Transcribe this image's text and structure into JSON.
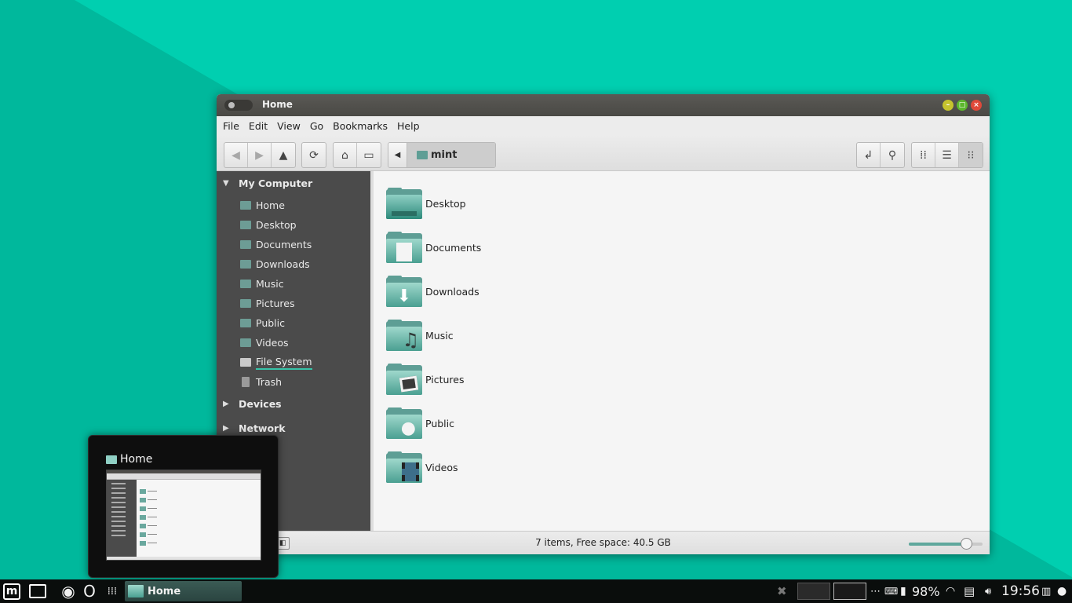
{
  "window": {
    "title": "Home",
    "menu": [
      "File",
      "Edit",
      "View",
      "Go",
      "Bookmarks",
      "Help"
    ],
    "pathbar": {
      "crumb": "mint"
    }
  },
  "sidebar": {
    "my_computer": "My Computer",
    "items": [
      {
        "label": "Home",
        "icon": "home-folder-icon"
      },
      {
        "label": "Desktop",
        "icon": "desktop-folder-icon"
      },
      {
        "label": "Documents",
        "icon": "documents-folder-icon"
      },
      {
        "label": "Downloads",
        "icon": "downloads-folder-icon"
      },
      {
        "label": "Music",
        "icon": "music-folder-icon"
      },
      {
        "label": "Pictures",
        "icon": "pictures-folder-icon"
      },
      {
        "label": "Public",
        "icon": "public-folder-icon"
      },
      {
        "label": "Videos",
        "icon": "videos-folder-icon"
      },
      {
        "label": "File System",
        "icon": "drive-icon"
      },
      {
        "label": "Trash",
        "icon": "trash-icon"
      }
    ],
    "devices": "Devices",
    "network": "Network"
  },
  "content": {
    "items": [
      {
        "name": "Desktop",
        "icon": "desktop-folder-icon"
      },
      {
        "name": "Documents",
        "icon": "documents-folder-icon"
      },
      {
        "name": "Downloads",
        "icon": "downloads-folder-icon"
      },
      {
        "name": "Music",
        "icon": "music-folder-icon"
      },
      {
        "name": "Pictures",
        "icon": "pictures-folder-icon"
      },
      {
        "name": "Public",
        "icon": "public-folder-icon"
      },
      {
        "name": "Videos",
        "icon": "videos-folder-icon"
      }
    ]
  },
  "statusbar": {
    "status": "7 items, Free space: 40.5 GB",
    "zoom_fraction": 0.78
  },
  "preview": {
    "title": "Home"
  },
  "taskbar": {
    "task_label": "Home",
    "battery": "98%",
    "clock": "19:56"
  },
  "colors": {
    "desktop": "#00cfb0",
    "accent": "#5e9e95",
    "sidebar": "#4b4b4b"
  }
}
